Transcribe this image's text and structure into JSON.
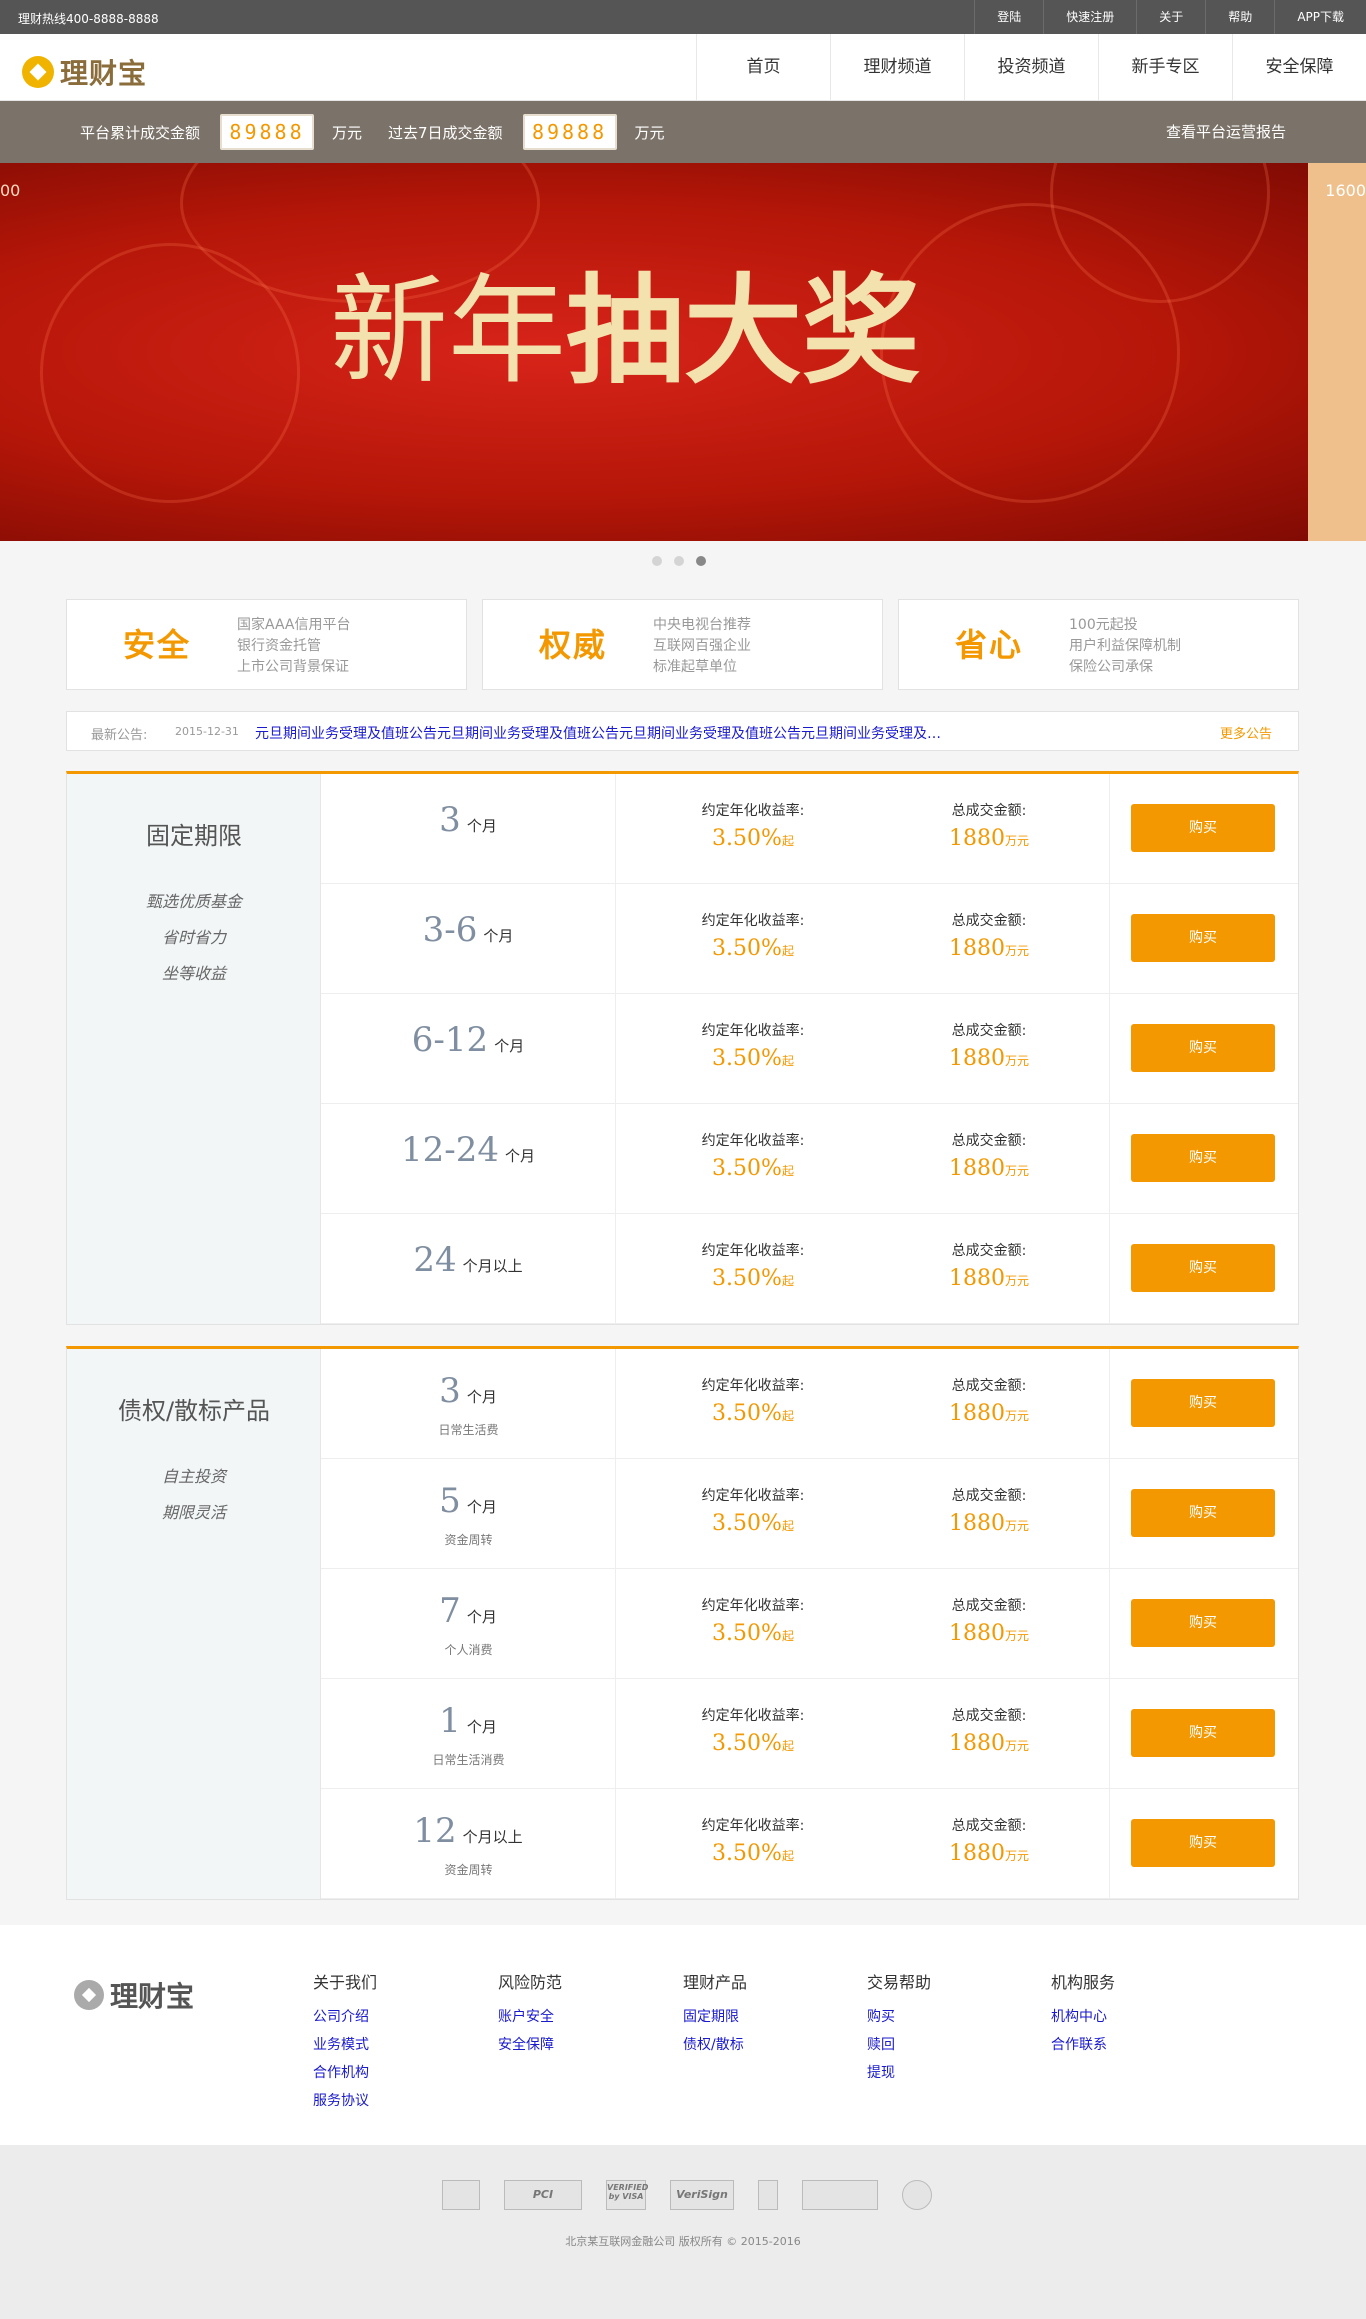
{
  "topbar": {
    "hotline": "理财热线400-8888-8888",
    "links": [
      "登陆",
      "快速注册",
      "关于",
      "帮助",
      "APP下载"
    ]
  },
  "nav": {
    "logo_text": "理财宝",
    "menu": [
      "首页",
      "理财频道",
      "投资频道",
      "新手专区",
      "安全保障"
    ]
  },
  "stats": {
    "total_label": "平台累计成交金额",
    "total_value": "89888",
    "unit1": "万元",
    "week_label": "过去7日成交金额",
    "week_value": "89888",
    "unit2": "万元",
    "report": "查看平台运营报告"
  },
  "banner": {
    "headline_thin": "新年",
    "headline_bold": "抽大奖",
    "left_num": "00",
    "right_num": "1600",
    "slides": 3,
    "active_slide": 3
  },
  "features": [
    {
      "title": "安全",
      "lines": [
        "国家AAA信用平台",
        "银行资金托管",
        "上市公司背景保证"
      ]
    },
    {
      "title": "权威",
      "lines": [
        "中央电视台推荐",
        "互联网百强企业",
        "标准起草单位"
      ]
    },
    {
      "title": "省心",
      "lines": [
        "100元起投",
        "用户利益保障机制",
        "保险公司承保"
      ]
    }
  ],
  "notice": {
    "label": "最新公告:",
    "date": "2015-12-31",
    "message": "元旦期间业务受理及值班公告元旦期间业务受理及值班公告元旦期间业务受理及值班公告元旦期间业务受理及…",
    "more": "更多公告"
  },
  "product_labels": {
    "rate_label": "约定年化收益率:",
    "total_label": "总成交金额:",
    "rate_suffix": "起",
    "total_suffix": "万元",
    "buy": "购买"
  },
  "fixed": {
    "name": "固定期限",
    "tags": [
      "甄选优质基金",
      "省时省力",
      "坐等收益"
    ],
    "rows": [
      {
        "term": "3",
        "unit": "个月",
        "rate": "3.50%",
        "total": "1880"
      },
      {
        "term": "3-6",
        "unit": "个月",
        "rate": "3.50%",
        "total": "1880"
      },
      {
        "term": "6-12",
        "unit": "个月",
        "rate": "3.50%",
        "total": "1880"
      },
      {
        "term": "12-24",
        "unit": "个月",
        "rate": "3.50%",
        "total": "1880"
      },
      {
        "term": "24",
        "unit": "个月以上",
        "rate": "3.50%",
        "total": "1880"
      }
    ]
  },
  "debt": {
    "name": "债权/散标产品",
    "tags": [
      "自主投资",
      "期限灵活"
    ],
    "rows": [
      {
        "term": "3",
        "unit": "个月",
        "sub": "日常生活费",
        "rate": "3.50%",
        "total": "1880"
      },
      {
        "term": "5",
        "unit": "个月",
        "sub": "资金周转",
        "rate": "3.50%",
        "total": "1880"
      },
      {
        "term": "7",
        "unit": "个月",
        "sub": "个人消费",
        "rate": "3.50%",
        "total": "1880"
      },
      {
        "term": "1",
        "unit": "个月",
        "sub": "日常生活消费",
        "rate": "3.50%",
        "total": "1880"
      },
      {
        "term": "12",
        "unit": "个月以上",
        "sub": "资金周转",
        "rate": "3.50%",
        "total": "1880"
      }
    ]
  },
  "footer": {
    "logo_text": "理财宝",
    "columns": [
      {
        "title": "关于我们",
        "links": [
          "公司介绍",
          "业务模式",
          "合作机构",
          "服务协议"
        ]
      },
      {
        "title": "风险防范",
        "links": [
          "账户安全",
          "安全保障"
        ]
      },
      {
        "title": "理财产品",
        "links": [
          "固定期限",
          "债权/散标"
        ]
      },
      {
        "title": "交易帮助",
        "links": [
          "购买",
          "赎回",
          "提现"
        ]
      },
      {
        "title": "机构服务",
        "links": [
          "机构中心",
          "合作联系"
        ]
      }
    ],
    "certs": [
      "",
      "PCI",
      "VERIFIED by VISA",
      "VeriSign",
      "",
      "",
      ""
    ],
    "copyright": "北京某互联网金融公司  版权所有 © 2015-2016"
  },
  "colors": {
    "accent": "#f39800",
    "stats_bg": "#7b7369",
    "topbar_bg": "#555555",
    "link": "#1a1acc"
  }
}
